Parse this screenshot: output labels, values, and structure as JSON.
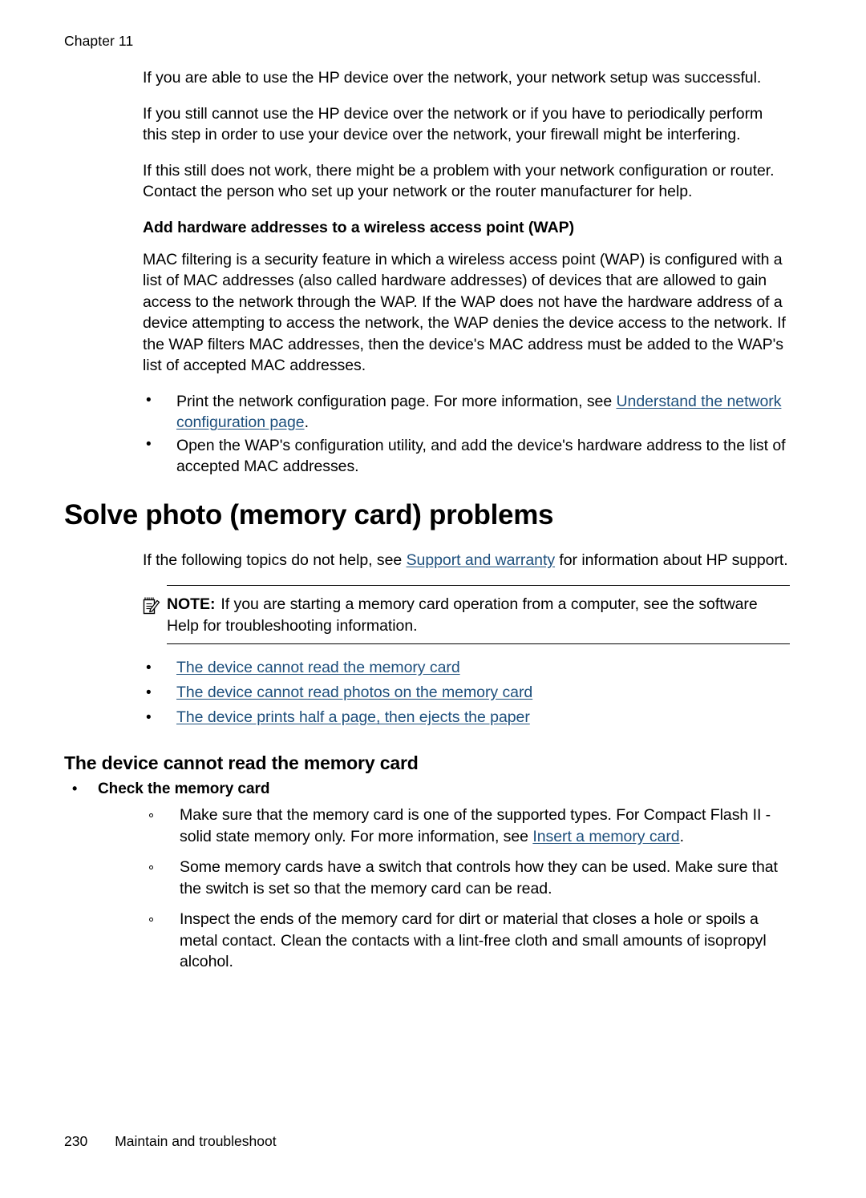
{
  "header": {
    "running_head": "Chapter 11"
  },
  "body": {
    "para1": "If you are able to use the HP device over the network, your network setup was successful.",
    "para2": "If you still cannot use the HP device over the network or if you have to periodically perform this step in order to use your device over the network, your firewall might be interfering.",
    "para3": "If this still does not work, there might be a problem with your network configuration or router. Contact the person who set up your network or the router manufacturer for help.",
    "wap_heading": "Add hardware addresses to a wireless access point (WAP)",
    "wap_para": "MAC filtering is a security feature in which a wireless access point (WAP) is configured with a list of MAC addresses (also called hardware addresses) of devices that are allowed to gain access to the network through the WAP. If the WAP does not have the hardware address of a device attempting to access the network, the WAP denies the device access to the network. If the WAP filters MAC addresses, then the device's MAC address must be added to the WAP's list of accepted MAC addresses.",
    "wap_bullets": [
      {
        "text_before": "Print the network configuration page. For more information, see ",
        "link": "Understand the network configuration page",
        "text_after": "."
      },
      {
        "text_before": "Open the WAP's configuration utility, and add the device's hardware address to the list of accepted MAC addresses.",
        "link": "",
        "text_after": ""
      }
    ]
  },
  "photo_section": {
    "title": "Solve photo (memory card) problems",
    "intro_before": "If the following topics do not help, see ",
    "intro_link": "Support and warranty",
    "intro_after": " for information about HP support.",
    "note": {
      "label": "NOTE:",
      "icon": "note-pencil-icon",
      "text": "If you are starting a memory card operation from a computer, see the software Help for troubleshooting information."
    },
    "topic_links": [
      "The device cannot read the memory card",
      "The device cannot read photos on the memory card",
      "The device prints half a page, then ejects the paper"
    ]
  },
  "cannot_read_section": {
    "title": "The device cannot read the memory card",
    "check_bullet": "Check the memory card",
    "sub_items": [
      {
        "text_before": "Make sure that the memory card is one of the supported types. For Compact Flash II - solid state memory only. For more information, see ",
        "link": "Insert a memory card",
        "text_after": "."
      },
      {
        "text_before": "Some memory cards have a switch that controls how they can be used. Make sure that the switch is set so that the memory card can be read.",
        "link": "",
        "text_after": ""
      },
      {
        "text_before": "Inspect the ends of the memory card for dirt or material that closes a hole or spoils a metal contact. Clean the contacts with a lint-free cloth and small amounts of isopropyl alcohol.",
        "link": "",
        "text_after": ""
      }
    ]
  },
  "footer": {
    "page_number": "230",
    "section_name": "Maintain and troubleshoot"
  },
  "colors": {
    "link": "#1d4f7c",
    "text": "#000000",
    "background": "#ffffff"
  }
}
